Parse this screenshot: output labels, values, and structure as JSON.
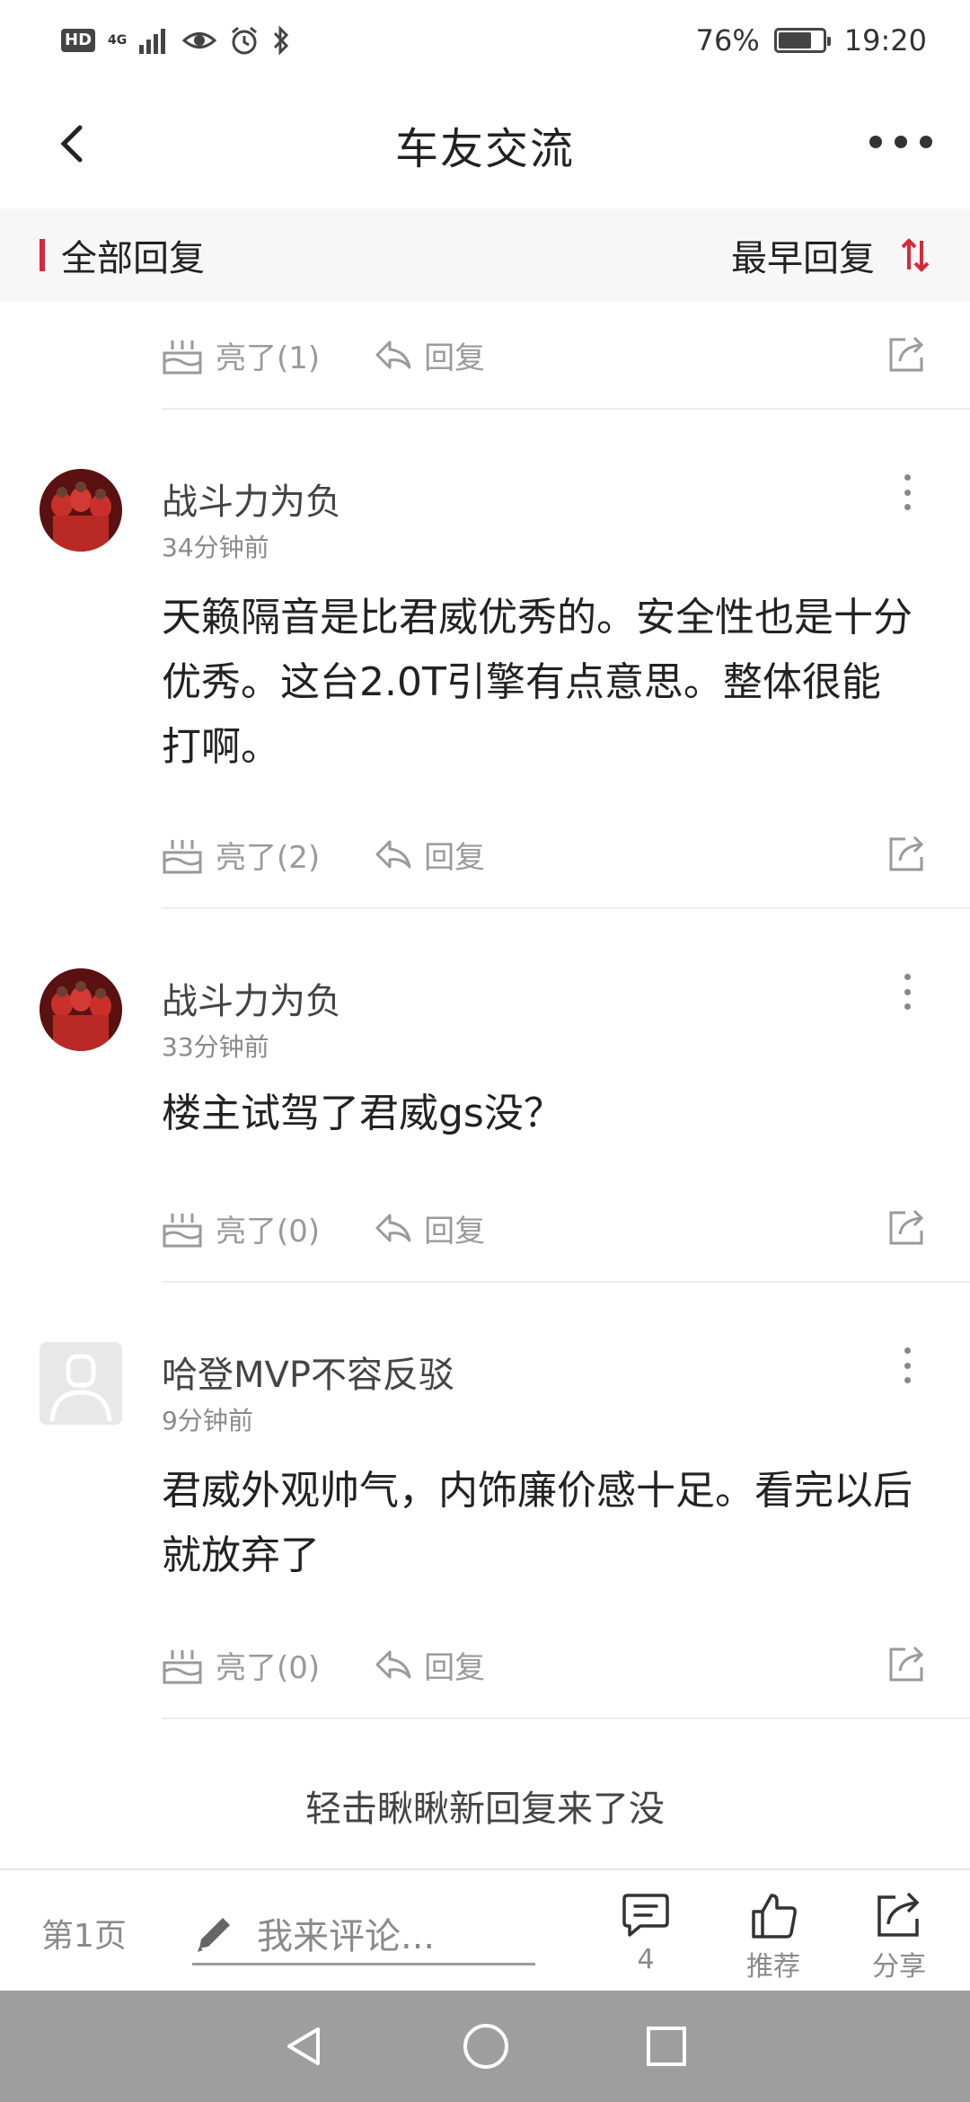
{
  "status_bar": {
    "hd": "HD",
    "network": "4G",
    "battery_percent": "76%",
    "battery_level": 0.76,
    "time": "19:20"
  },
  "nav": {
    "title": "车友交流"
  },
  "section": {
    "title": "全部回复",
    "sort_label": "最早回复"
  },
  "first_actions": {
    "like": "亮了(1)",
    "reply": "回复"
  },
  "comments": [
    {
      "username": "战斗力为负",
      "time": "34分钟前",
      "text": "天籁隔音是比君威优秀的。安全性也是十分优秀。这台2.0T引擎有点意思。整体很能打啊。",
      "like": "亮了(2)",
      "reply": "回复",
      "avatar": "photo-avatar"
    },
    {
      "username": "战斗力为负",
      "time": "33分钟前",
      "text": "楼主试驾了君威gs没？",
      "like": "亮了(0)",
      "reply": "回复",
      "avatar": "photo-avatar"
    },
    {
      "username": "哈登MVP不容反驳",
      "time": "9分钟前",
      "text": "君威外观帅气，内饰廉价感十足。看完以后就放弃了",
      "like": "亮了(0)",
      "reply": "回复",
      "avatar": "default-avatar"
    }
  ],
  "load_more": "轻击瞅瞅新回复来了没",
  "bottom_bar": {
    "page": "第1页",
    "comment_placeholder": "我来评论...",
    "comment_count": "4",
    "recommend_label": "推荐",
    "share_label": "分享"
  },
  "colors": {
    "accent": "#d8283a",
    "muted": "#9a9a9a",
    "text": "#222222"
  }
}
